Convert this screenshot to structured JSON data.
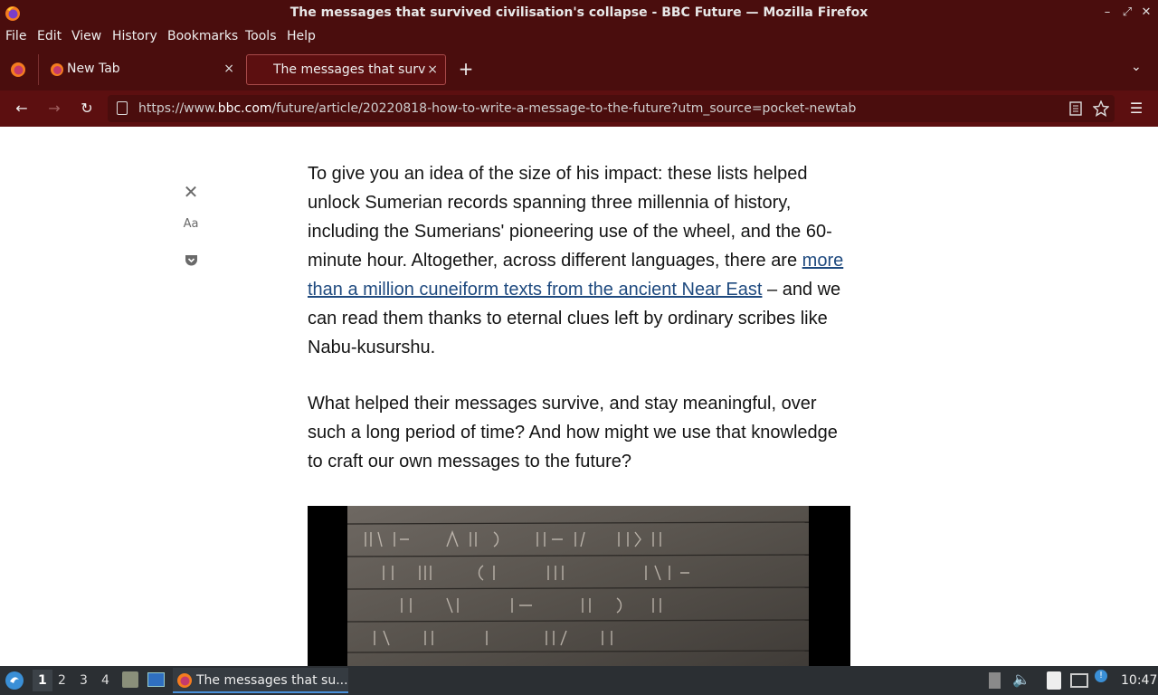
{
  "window": {
    "title": "The messages that survived civilisation's collapse - BBC Future — Mozilla Firefox"
  },
  "menu": {
    "items": [
      "File",
      "Edit",
      "View",
      "History",
      "Bookmarks",
      "Tools",
      "Help"
    ]
  },
  "tabs": [
    {
      "label": "New Tab",
      "close": "×"
    },
    {
      "label": "The messages that survi",
      "close": "×"
    }
  ],
  "newtab": "+",
  "nav": {
    "url_prefix": "https://www.",
    "url_domain": "bbc.com",
    "url_rest": "/future/article/20220818-how-to-write-a-message-to-the-future?utm_source=pocket-newtab"
  },
  "reader": {
    "font_label": "Aa"
  },
  "article": {
    "p1_before": "To give you an idea of the size of his impact: these lists helped unlock Sumerian records spanning three millennia of history, including the Sumerians' pioneering use of the wheel, and the 60-minute hour. Altogether, across different languages, there are ",
    "p1_link": "more than a million cuneiform texts from the ancient Near East",
    "p1_after": " – and we can read them thanks to eternal clues left by ordinary scribes like Nabu-kusurshu.",
    "p2": "What helped their messages survive, and stay meaningful, over such a long period of time? And how might we use that knowledge to craft our own messages to the future?"
  },
  "taskbar": {
    "workspaces": [
      "1",
      "2",
      "3",
      "4"
    ],
    "window_label": "The messages that su...",
    "clock": "10:47"
  },
  "colors": {
    "chrome_dark": "#4a0d0d",
    "toolbar": "#5c0f10",
    "link": "#1f4a7f",
    "taskbar": "#2b2f33"
  }
}
